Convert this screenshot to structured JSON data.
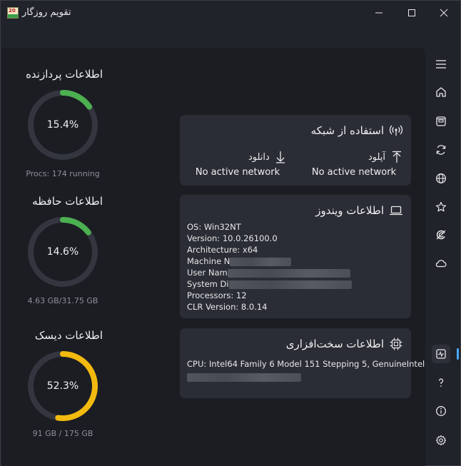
{
  "app": {
    "title": "تقویم روزگار",
    "icon_number": "20"
  },
  "window_controls": [
    "minimize-icon",
    "maximize-icon",
    "close-icon"
  ],
  "nav": {
    "top": [
      "hamburger-menu-icon",
      "home-icon",
      "calendar-icon",
      "sync-icon",
      "globe-icon",
      "star-icon",
      "internet-explorer-icon",
      "cloud-icon"
    ],
    "bottom": [
      "system-monitor-icon",
      "help-icon",
      "info-icon",
      "settings-icon"
    ],
    "active": "system-monitor-icon"
  },
  "gauges": [
    {
      "title": "اطلاعات پردازنده",
      "value": "15.4%",
      "percent": 15.4,
      "sub": "Procs: 174 running",
      "color": "#4caf50"
    },
    {
      "title": "اطلاعات حافظه",
      "value": "14.6%",
      "percent": 14.6,
      "sub": "4.63 GB/31.75 GB",
      "color": "#4caf50"
    },
    {
      "title": "اطلاعات دیسک",
      "value": "52.3%",
      "percent": 52.3,
      "sub": "91 GB / 175 GB",
      "color": "#f2b90f"
    }
  ],
  "network": {
    "title": "استفاده از شبکه",
    "upload_label": "آپلود",
    "download_label": "دانلود",
    "upload_value": "No active network",
    "download_value": "No active network"
  },
  "windows": {
    "title": "اطلاعات ویندوز",
    "lines": {
      "os": "OS: Win32NT",
      "version": "Version: 10.0.26100.0",
      "architecture": "Architecture: x64",
      "machine": "Machine N",
      "user": "User Nam",
      "system_dir": "System Di",
      "processors": "Processors: 12",
      "clr": "CLR Version: 8.0.14"
    }
  },
  "hardware": {
    "title": "اطلاعات سخت‌افزاری",
    "cpu": "CPU: Intel64 Family 6 Model 151 Stepping 5, GenuineIntel"
  }
}
